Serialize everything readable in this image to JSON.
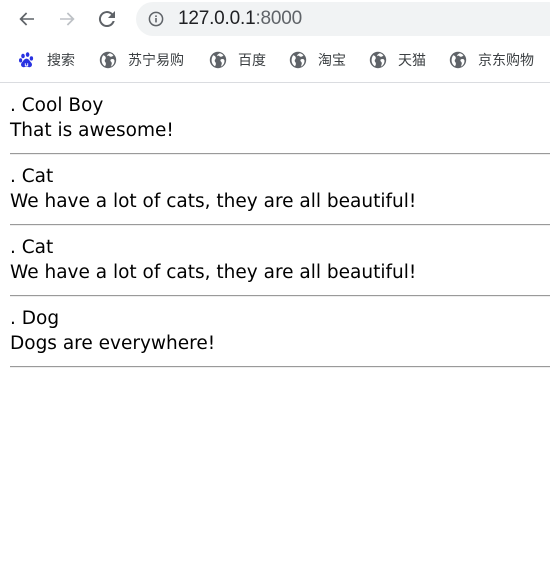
{
  "browser": {
    "url_host": "127.0.0.1",
    "url_port": ":8000",
    "icons": {
      "back": "back-arrow-icon",
      "forward": "forward-arrow-icon",
      "reload": "reload-icon",
      "site_info": "info-icon"
    }
  },
  "bookmarks": [
    {
      "label": "搜索",
      "icon": "baidu-paw-icon"
    },
    {
      "label": "苏宁易购",
      "icon": "globe-icon"
    },
    {
      "label": "百度",
      "icon": "globe-icon"
    },
    {
      "label": "淘宝",
      "icon": "globe-icon"
    },
    {
      "label": "天猫",
      "icon": "globe-icon"
    },
    {
      "label": "京东购物",
      "icon": "globe-icon"
    }
  ],
  "posts": [
    {
      "title": ". Cool Boy",
      "body": "That is awesome!"
    },
    {
      "title": ". Cat",
      "body": "We have a lot of cats, they are all beautiful!"
    },
    {
      "title": ". Cat",
      "body": "We have a lot of cats, they are all beautiful!"
    },
    {
      "title": ". Dog",
      "body": "Dogs are everywhere!"
    }
  ],
  "colors": {
    "omnibox_bg": "#f1f3f4",
    "icon_gray": "#5f6368",
    "paw_blue": "#2932e1"
  }
}
